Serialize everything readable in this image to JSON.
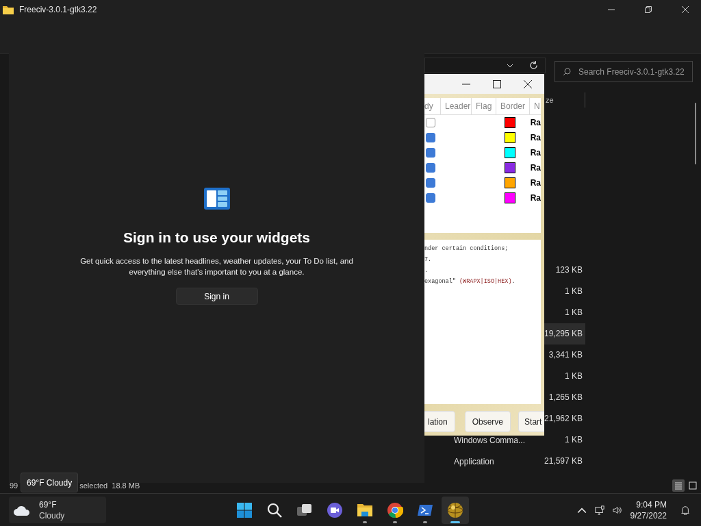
{
  "explorer": {
    "title": "Freeciv-3.0.1-gtk3.22",
    "search": {
      "placeholder": "Search Freeciv-3.0.1-gtk3.22"
    },
    "column_header": "ze",
    "files": [
      {
        "size": "123 KB",
        "selected": false
      },
      {
        "size": "1 KB",
        "selected": false
      },
      {
        "size": "1 KB",
        "selected": false
      },
      {
        "size": "19,295 KB",
        "selected": true
      },
      {
        "size": "3,341 KB",
        "selected": false
      },
      {
        "size": "1 KB",
        "selected": false
      },
      {
        "size": "1,265 KB",
        "selected": false
      },
      {
        "size": "21,962 KB",
        "selected": false
      },
      {
        "type": "Windows Comma...",
        "size": "1 KB",
        "selected": false
      },
      {
        "type": "Application",
        "size": "21,597 KB",
        "selected": false
      }
    ],
    "status_bar": {
      "item_count": "99",
      "selection": "selected  18.8 MB"
    },
    "views": [
      {
        "kind": "details",
        "selected": true
      },
      {
        "kind": "tiles",
        "selected": false
      }
    ]
  },
  "widgets": {
    "heading": "Sign in to use your widgets",
    "message": "Get quick access to the latest headlines, weather updates, your To Do list, and everything else that's important to you at a glance.",
    "button": "Sign in"
  },
  "freeciv": {
    "columns": [
      "dy",
      "Leader",
      "Flag",
      "Border",
      "N"
    ],
    "players": [
      {
        "ready": false,
        "color": "#ff0000",
        "name": "Ra"
      },
      {
        "ready": true,
        "color": "#ffff00",
        "name": "Ra"
      },
      {
        "ready": true,
        "color": "#00ffff",
        "name": "Ra"
      },
      {
        "ready": true,
        "color": "#8a2be2",
        "name": "Ra"
      },
      {
        "ready": true,
        "color": "#ffa500",
        "name": "Ra"
      },
      {
        "ready": true,
        "color": "#ff00ff",
        "name": "Ra"
      }
    ],
    "log": [
      {
        "text": "nder certain conditions;"
      },
      {
        "text": "7."
      },
      {
        "text": "."
      },
      {
        "text": "exagonal\" ",
        "flags": "(WRAPX|ISO|HEX)",
        "end": "."
      }
    ],
    "buttons": [
      "lation",
      "Observe",
      "Start"
    ]
  },
  "taskbar": {
    "weather": {
      "temperature": "69°F",
      "condition": "Cloudy"
    },
    "tooltip": "69°F Cloudy",
    "apps": [
      {
        "kind": "start",
        "running": false,
        "active": false
      },
      {
        "kind": "search",
        "running": false,
        "active": false
      },
      {
        "kind": "taskview",
        "running": false,
        "active": false
      },
      {
        "kind": "meet",
        "running": false,
        "active": false
      },
      {
        "kind": "explorer",
        "running": true,
        "active": false
      },
      {
        "kind": "chrome",
        "running": true,
        "active": false
      },
      {
        "kind": "terminal",
        "running": true,
        "active": false
      },
      {
        "kind": "freeciv",
        "running": true,
        "active": true
      }
    ],
    "clock": {
      "time": "9:04 PM",
      "date": "9/27/2022"
    }
  }
}
